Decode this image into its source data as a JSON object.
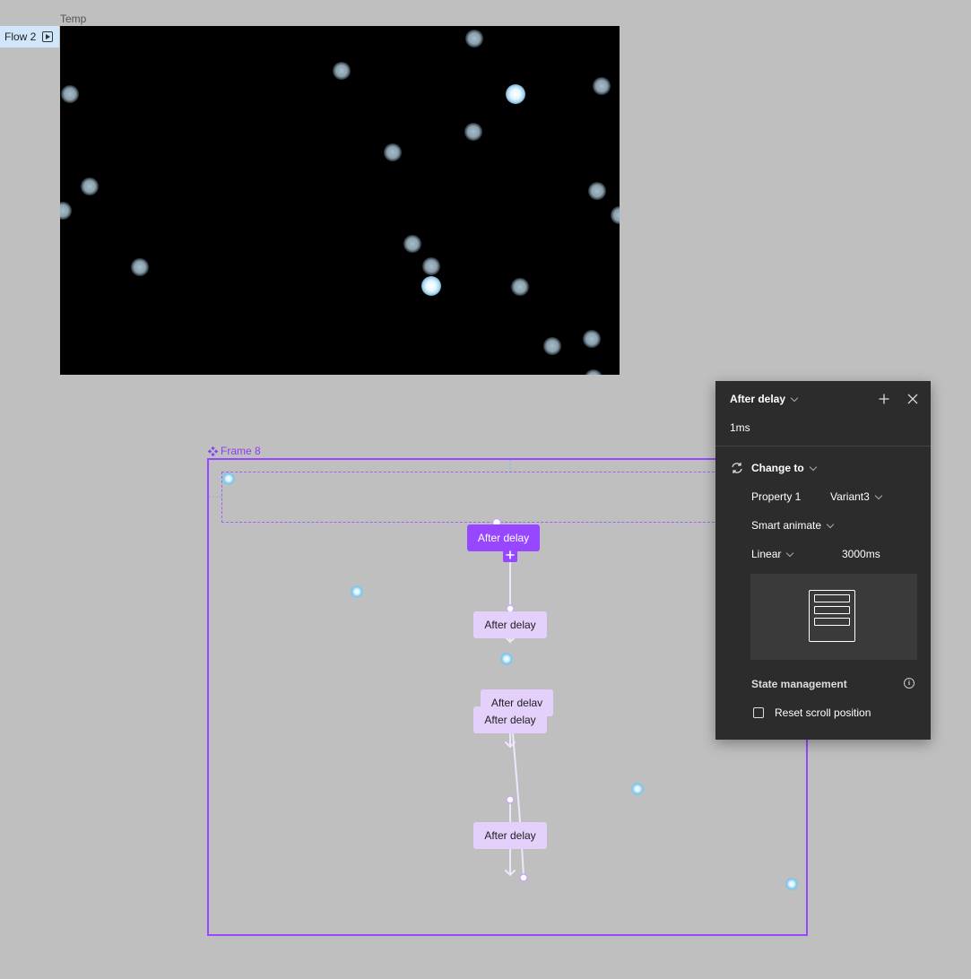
{
  "canvas": {
    "temp_frame_label": "Temp",
    "flow_tag_label": "Flow 2",
    "frame8_label": "Frame 8"
  },
  "flow": {
    "nodes": [
      {
        "label": "After delay",
        "active": true
      },
      {
        "label": "After delay",
        "active": false
      },
      {
        "label": "After delay",
        "active": false
      },
      {
        "label": "After delay",
        "active": false
      },
      {
        "label": "After delay",
        "active": false
      }
    ]
  },
  "panel": {
    "trigger": "After delay",
    "delay_value": "1ms",
    "action": "Change to",
    "property_name": "Property 1",
    "property_value": "Variant3",
    "animation": "Smart animate",
    "easing": "Linear",
    "duration": "3000ms",
    "state_management_label": "State management",
    "reset_scroll_label": "Reset scroll position",
    "reset_scroll_checked": false
  },
  "colors": {
    "accent": "#9747ff",
    "accent_light": "#e3d1fb",
    "panel_bg": "#2c2c2c",
    "canvas_bg": "#bfbfbf"
  }
}
